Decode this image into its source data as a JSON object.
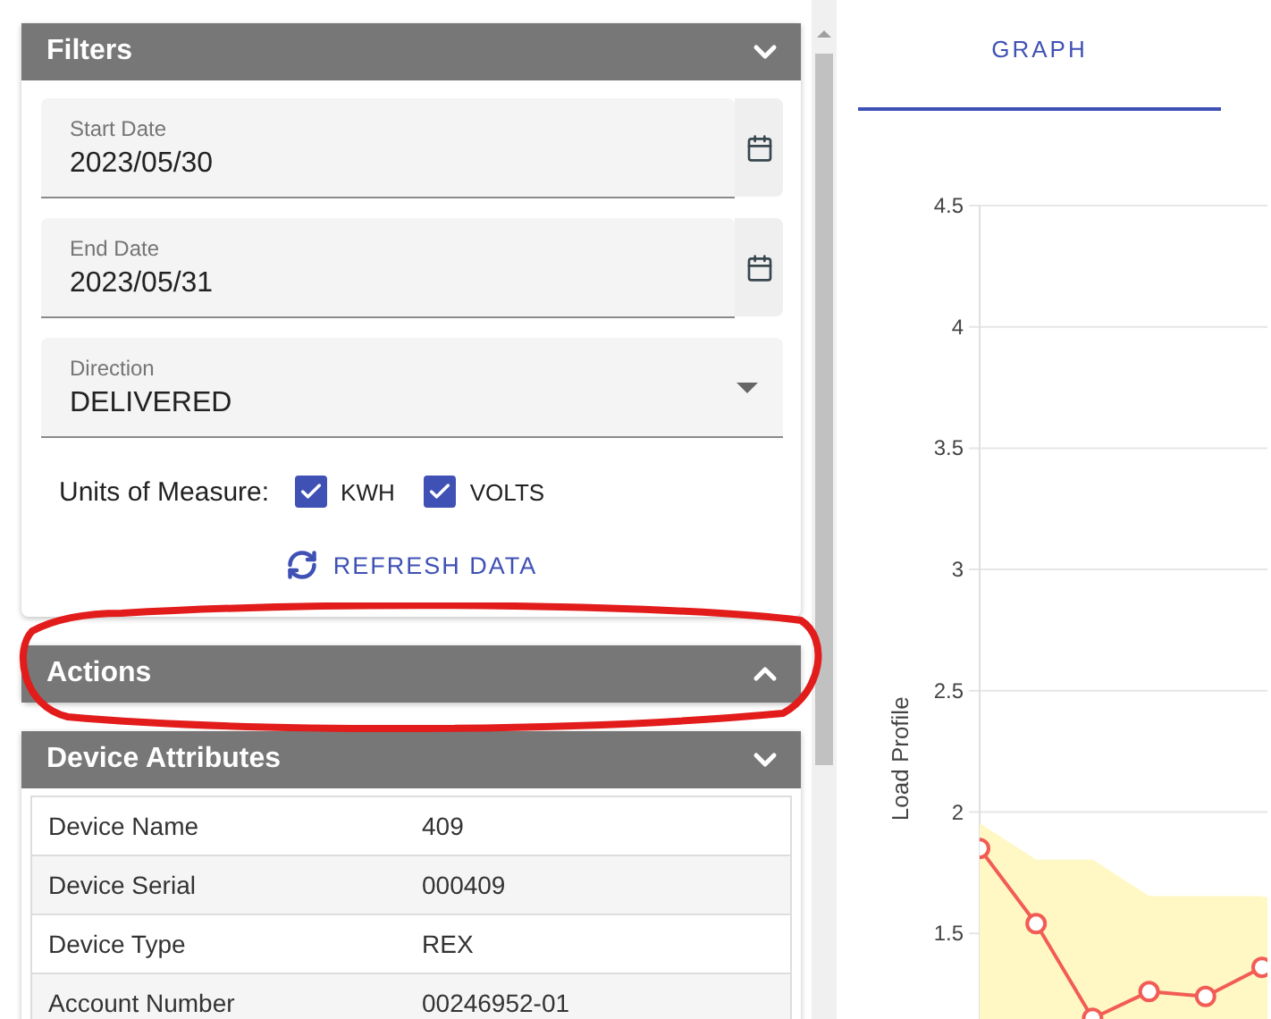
{
  "panels": [
    {
      "kind": "filters",
      "title": "Filters",
      "expanded": true,
      "fields": [
        {
          "kind": "date",
          "label": "Start Date",
          "value": "2023/05/30"
        },
        {
          "kind": "date",
          "label": "End Date",
          "value": "2023/05/31"
        },
        {
          "kind": "select",
          "label": "Direction",
          "value": "DELIVERED"
        }
      ],
      "units_label": "Units of Measure:",
      "units": [
        {
          "label": "KWH",
          "checked": true
        },
        {
          "label": "VOLTS",
          "checked": true
        }
      ],
      "refresh_button": "REFRESH DATA"
    },
    {
      "kind": "empty",
      "title": "Actions",
      "expanded": false
    },
    {
      "kind": "attributes",
      "title": "Device Attributes",
      "expanded": true,
      "rows": [
        {
          "name": "Device Name",
          "value": "409"
        },
        {
          "name": "Device Serial",
          "value": "000409"
        },
        {
          "name": "Device Type",
          "value": "REX"
        },
        {
          "name": "Account Number",
          "value": "00246952-01"
        }
      ]
    }
  ],
  "tabs": [
    {
      "label": "GRAPH",
      "selected": true
    }
  ],
  "chart_data": {
    "type": "line",
    "grid": true,
    "ylabel": "Load Profile",
    "ylim": [
      1.15,
      4.5
    ],
    "yticks": [
      1.5,
      2,
      2.5,
      3,
      3.5,
      4,
      4.5
    ],
    "series": [
      {
        "type": "area",
        "color": "#fff8c4",
        "values": [
          1.95,
          1.8,
          1.8,
          1.65,
          1.65,
          1.65
        ]
      },
      {
        "type": "line",
        "marker": "circle",
        "color": "#f25c54",
        "values": [
          1.85,
          1.54,
          1.15,
          1.26,
          1.24,
          1.36
        ]
      }
    ]
  }
}
